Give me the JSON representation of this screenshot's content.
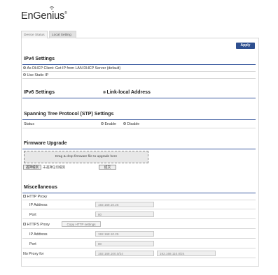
{
  "brand": {
    "logo_text": "EnGenius",
    "registered_mark": "®"
  },
  "tabs": [
    {
      "label": "Device Status",
      "active": false
    },
    {
      "label": "Local Setting",
      "active": true
    }
  ],
  "apply_label": "Apply",
  "ipv4": {
    "title": "IPv4 Settings",
    "options": [
      {
        "label": "As DHCP Client: Get IP from LAN DHCP Server (default)",
        "selected": true
      },
      {
        "label": "Use Static IP",
        "selected": false
      }
    ]
  },
  "ipv6": {
    "title": "IPv6 Settings",
    "link_local_label": "Link-local Address"
  },
  "stp": {
    "title": "Spanning Tree Protocol (STP) Settings",
    "status_label": "Status",
    "enable_label": "Enable",
    "disable_label": "Disable",
    "selected": "Disable"
  },
  "firmware": {
    "title": "Firmware Upgrade",
    "drop_text": "Drag & drop firmware file to upgrade here",
    "choose_file_label": "選擇檔案",
    "no_file_text": "未選擇任何檔案",
    "submit_label": "提交"
  },
  "misc": {
    "title": "Miscellaneous",
    "http_proxy_label": "HTTP Proxy",
    "http_ip_label": "IP Address",
    "http_ip_value": "192.168.10.25",
    "http_port_label": "Port",
    "http_port_value": "80",
    "https_proxy_label": "HTTPS Proxy",
    "copy_http_label": "Copy HTTP settings",
    "https_ip_label": "IP Address",
    "https_ip_value": "192.168.10.25",
    "https_port_label": "Port",
    "https_port_value": "80",
    "no_proxy_label": "No Proxy for",
    "no_proxy_values": [
      "192.168.100.0/24",
      "192.168.110.0/24"
    ]
  },
  "colors": {
    "accent": "#2e4f8f",
    "section_rule": "#3b5aa0"
  }
}
